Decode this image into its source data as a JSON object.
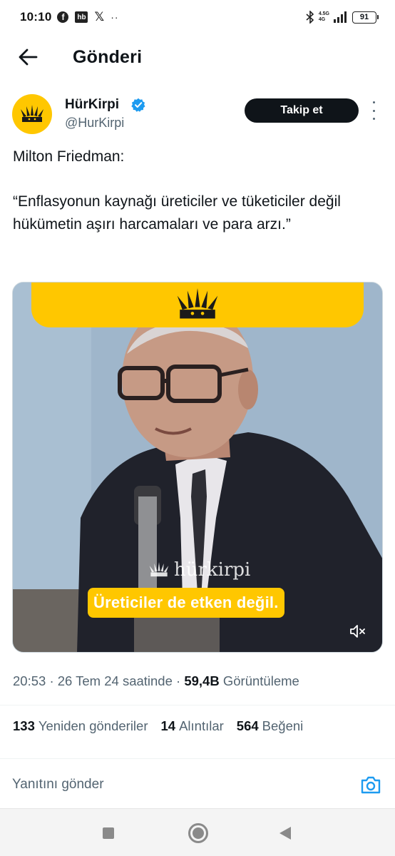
{
  "status_bar": {
    "time": "10:10",
    "app_icons": [
      "facebook-icon",
      "hb-icon",
      "x-icon",
      "more-notifications-icon"
    ],
    "hb_label": "hb",
    "network_label_top": "4.5G",
    "network_label_bottom": "4G",
    "battery": "91"
  },
  "header": {
    "title": "Gönderi"
  },
  "author": {
    "display_name": "HürKirpi",
    "handle": "@HurKirpi",
    "verified": true,
    "follow_label": "Takip et"
  },
  "tweet": {
    "text": "Milton Friedman:\n\n“Enflasyonun kaynağı üreticiler ve tüketiciler değil hükümetin aşırı harcamaları ve para arzı.”"
  },
  "media": {
    "watermark": "hürkirpi",
    "caption": "Üreticiler de etken değil.",
    "muted": true
  },
  "meta": {
    "time": "20:53",
    "date": "26 Tem 24 saatinde",
    "views_count": "59,4B",
    "views_label": "Görüntüleme"
  },
  "stats": {
    "reposts_count": "133",
    "reposts_label": "Yeniden gönderiler",
    "quotes_count": "14",
    "quotes_label": "Alıntılar",
    "likes_count": "564",
    "likes_label": "Beğeni"
  },
  "reply": {
    "placeholder": "Yanıtını gönder"
  },
  "colors": {
    "brand_yellow": "#ffc700",
    "verified_blue": "#1d9bf0",
    "text_primary": "#0f1419",
    "text_secondary": "#536471"
  }
}
